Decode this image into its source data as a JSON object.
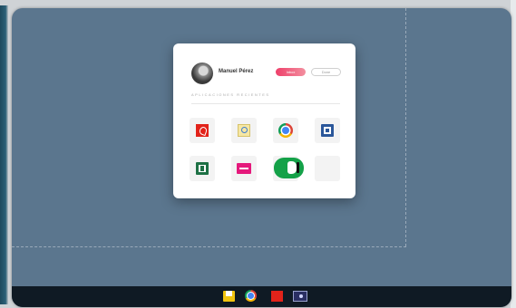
{
  "launcher": {
    "user_name": "Manuel Pérez",
    "primary_button": "Inbox",
    "secondary_button": "Done",
    "section_title": "APLICACIONES RECIENTES",
    "apps": [
      {
        "icon": "pdf-icon"
      },
      {
        "icon": "search-icon"
      },
      {
        "icon": "chrome-icon"
      },
      {
        "icon": "word-icon"
      },
      {
        "icon": "excel-icon"
      },
      {
        "icon": "pink-app-icon"
      },
      {
        "icon": "evernote-icon"
      },
      {
        "icon": "empty-slot"
      }
    ]
  },
  "taskbar": {
    "items": [
      {
        "icon": "file-explorer-icon"
      },
      {
        "icon": "chrome-icon"
      },
      {
        "icon": "pdf-icon"
      },
      {
        "icon": "photos-icon"
      }
    ]
  },
  "colors": {
    "desktop": "#5b768e",
    "taskbar": "#0f1a24",
    "primary_button": "#ee3f6a"
  }
}
